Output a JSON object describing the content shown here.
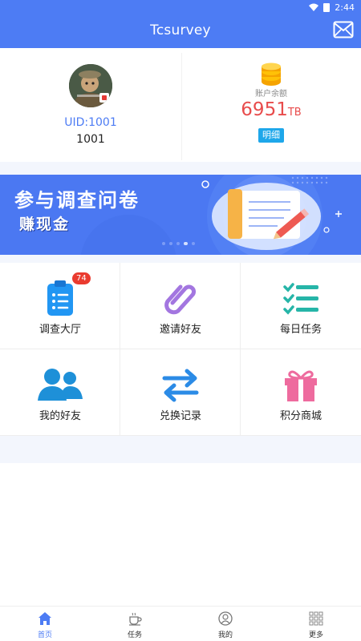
{
  "status_bar": {
    "time": "2:44",
    "icons": [
      "wifi-icon",
      "battery-icon"
    ]
  },
  "app_bar": {
    "title": "Tcsurvey",
    "action_icon": "mail-icon"
  },
  "profile": {
    "uid": "UID:1001",
    "username": "1001",
    "balance_label": "账户余额",
    "balance_value": "6951",
    "balance_unit": "TB",
    "detail_button": "明细"
  },
  "banner": {
    "headline": "参与调查问卷",
    "subline": "赚现金",
    "slides": 5,
    "active_slide": 4
  },
  "grid": [
    {
      "label": "调查大厅",
      "icon": "clipboard-list-icon",
      "badge": "74",
      "color": "#2196f3"
    },
    {
      "label": "邀请好友",
      "icon": "paperclip-icon",
      "badge": null,
      "color": "#a376e0"
    },
    {
      "label": "每日任务",
      "icon": "checklist-icon",
      "badge": null,
      "color": "#26b5a8"
    },
    {
      "label": "我的好友",
      "icon": "friends-icon",
      "badge": null,
      "color": "#1e90d8"
    },
    {
      "label": "兑换记录",
      "icon": "exchange-arrows-icon",
      "badge": null,
      "color": "#2b8be6"
    },
    {
      "label": "积分商城",
      "icon": "gift-icon",
      "badge": null,
      "color": "#ee6b9e"
    }
  ],
  "tabs": [
    {
      "label": "首页",
      "icon": "home-icon",
      "active": true
    },
    {
      "label": "任务",
      "icon": "coffee-cup-icon",
      "active": false
    },
    {
      "label": "我的",
      "icon": "user-circle-icon",
      "active": false
    },
    {
      "label": "更多",
      "icon": "grid-apps-icon",
      "active": false
    }
  ],
  "colors": {
    "primary": "#4d7cf4",
    "balance": "#e84c4c",
    "detail_button": "#1ea7ea",
    "badge": "#ea3b2f",
    "section_bg": "#f3f6fd"
  }
}
